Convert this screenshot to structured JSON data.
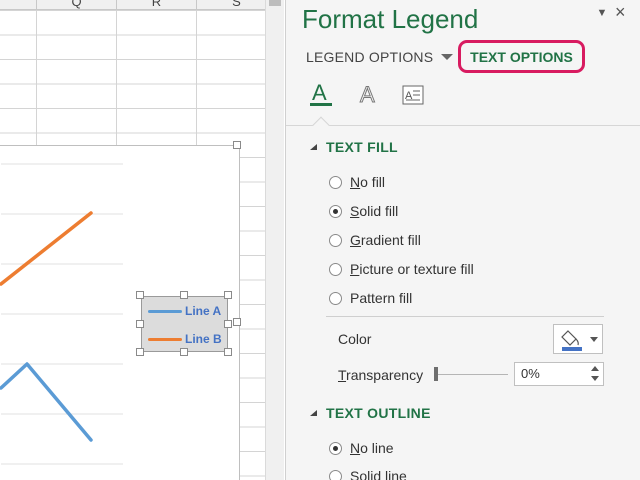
{
  "sheet": {
    "columns": [
      "Q",
      "R",
      "S"
    ]
  },
  "chart": {
    "legend": {
      "items": [
        {
          "label": "Line A",
          "color": "#5b9bd5"
        },
        {
          "label": "Line B",
          "color": "#ed7d31"
        }
      ]
    },
    "series": [
      {
        "color": "#ed7d31"
      },
      {
        "color": "#5b9bd5"
      }
    ]
  },
  "pane": {
    "title": "Format Legend",
    "collapse_icon": "chevron-down-icon",
    "close_label": "×",
    "tabs": {
      "legend_options": "LEGEND OPTIONS",
      "text_options": "TEXT OPTIONS"
    },
    "subtabs": [
      "text-fill-outline-icon",
      "text-effects-icon",
      "textbox-icon"
    ],
    "text_fill": {
      "header": "TEXT FILL",
      "options": [
        {
          "label": "No fill",
          "underline_char": "N",
          "rest": "o fill",
          "checked": false
        },
        {
          "label": "Solid fill",
          "underline_char": "S",
          "rest": "olid fill",
          "checked": true
        },
        {
          "label": "Gradient fill",
          "underline_char": "G",
          "rest": "radient fill",
          "checked": false
        },
        {
          "label": "Picture or texture fill",
          "underline_char": "P",
          "rest": "icture or texture fill",
          "checked": false
        },
        {
          "label": "Pattern fill",
          "underline_char": "A",
          "rest": "Pattern fill",
          "checked": false
        }
      ],
      "color_label": "Color",
      "color_value": "#4472c4",
      "transparency_label": "Transparency",
      "transparency_value": "0%"
    },
    "text_outline": {
      "header": "TEXT OUTLINE",
      "options": [
        {
          "label": "No line",
          "checked": true
        },
        {
          "label": "Solid line",
          "checked": false
        }
      ]
    },
    "accent": "#217346",
    "highlight": "#d81b60"
  }
}
